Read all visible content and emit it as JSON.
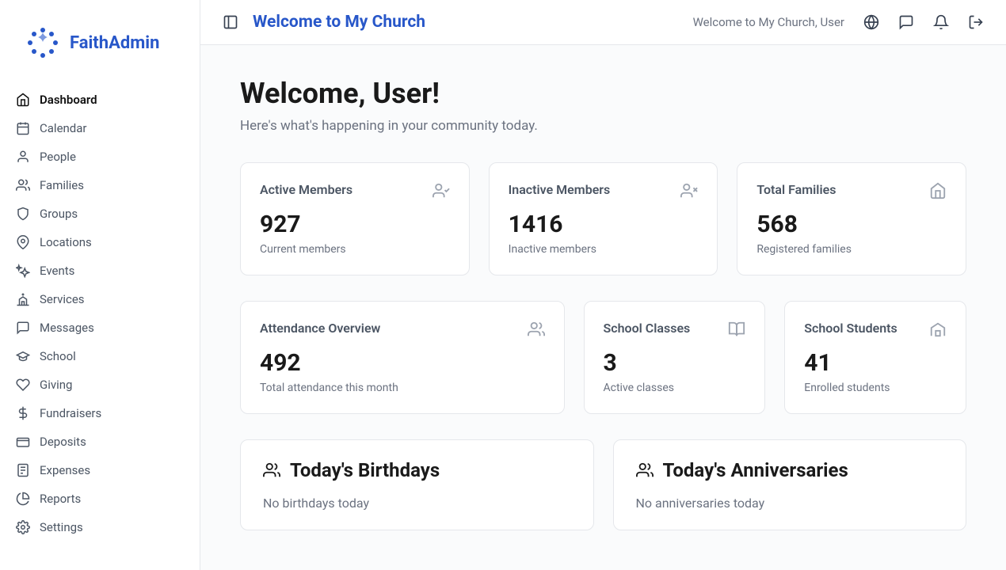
{
  "brand": {
    "name": "FaithAdmin"
  },
  "sidebar": {
    "items": [
      {
        "label": "Dashboard",
        "icon": "home"
      },
      {
        "label": "Calendar",
        "icon": "calendar"
      },
      {
        "label": "People",
        "icon": "user"
      },
      {
        "label": "Families",
        "icon": "users"
      },
      {
        "label": "Groups",
        "icon": "shield"
      },
      {
        "label": "Locations",
        "icon": "pin"
      },
      {
        "label": "Events",
        "icon": "sparkle"
      },
      {
        "label": "Services",
        "icon": "church"
      },
      {
        "label": "Messages",
        "icon": "message"
      },
      {
        "label": "School",
        "icon": "graduation"
      },
      {
        "label": "Giving",
        "icon": "heart"
      },
      {
        "label": "Fundraisers",
        "icon": "dollar"
      },
      {
        "label": "Deposits",
        "icon": "wallet"
      },
      {
        "label": "Expenses",
        "icon": "receipt"
      },
      {
        "label": "Reports",
        "icon": "piechart"
      },
      {
        "label": "Settings",
        "icon": "gear"
      }
    ]
  },
  "topbar": {
    "title": "Welcome to My Church",
    "greeting": "Welcome to My Church, User"
  },
  "welcome": {
    "title": "Welcome, User!",
    "subtitle": "Here's what's happening in your community today."
  },
  "stats_row1": [
    {
      "title": "Active Members",
      "value": "927",
      "desc": "Current members",
      "icon": "user-check"
    },
    {
      "title": "Inactive Members",
      "value": "1416",
      "desc": "Inactive members",
      "icon": "user-x"
    },
    {
      "title": "Total Families",
      "value": "568",
      "desc": "Registered families",
      "icon": "home"
    }
  ],
  "stats_row2": [
    {
      "title": "Attendance Overview",
      "value": "492",
      "desc": "Total attendance this month",
      "icon": "users"
    },
    {
      "title": "School Classes",
      "value": "3",
      "desc": "Active classes",
      "icon": "book"
    },
    {
      "title": "School Students",
      "value": "41",
      "desc": "Enrolled students",
      "icon": "school"
    }
  ],
  "events": {
    "birthdays": {
      "title": "Today's Birthdays",
      "empty": "No birthdays today"
    },
    "anniversaries": {
      "title": "Today's Anniversaries",
      "empty": "No anniversaries today"
    }
  }
}
